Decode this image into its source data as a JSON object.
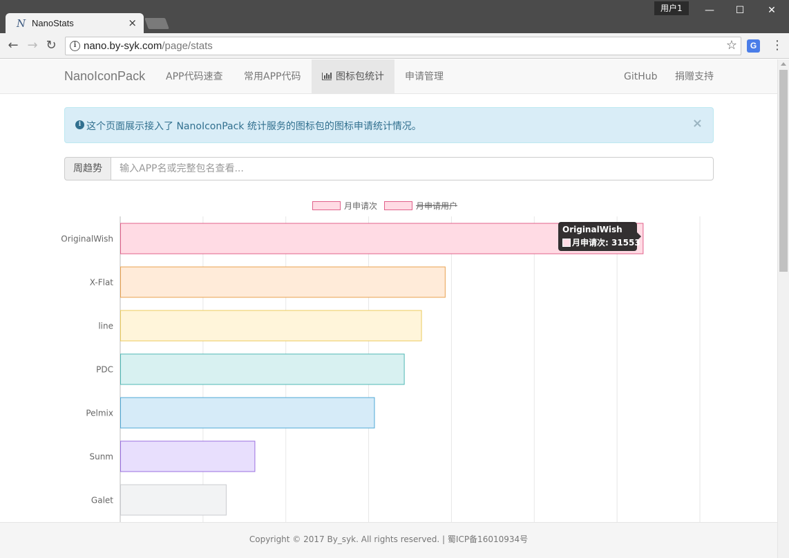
{
  "browser": {
    "tab_title": "NanoStats",
    "tab_favicon": "N",
    "profile_name": "用户1",
    "url_host": "nano.by-syk.com",
    "url_path": "/page/stats",
    "extension_letter": "G"
  },
  "navbar": {
    "brand": "NanoIconPack",
    "links": [
      {
        "label": "APP代码速查"
      },
      {
        "label": "常用APP代码"
      },
      {
        "label": "图标包统计",
        "active": true
      },
      {
        "label": "申请管理"
      }
    ],
    "right_links": [
      {
        "label": "GitHub"
      },
      {
        "label": "捐赠支持"
      }
    ]
  },
  "alert": {
    "text": "这个页面展示接入了 NanoIconPack 统计服务的图标包的图标申请统计情况。",
    "close_glyph": "×"
  },
  "search": {
    "addon_label": "周趋势",
    "placeholder": "输入APP名或完整包名查看..."
  },
  "chart_data": {
    "type": "bar",
    "orientation": "horizontal",
    "categories": [
      "OriginalWish",
      "X-Flat",
      "line",
      "PDC",
      "Pelmix",
      "Sunm",
      "Galet"
    ],
    "series": [
      {
        "name": "月申请次",
        "values": [
          31553,
          19600,
          18170,
          17130,
          15330,
          8110,
          6380
        ],
        "hidden": false
      },
      {
        "name": "月申请用户",
        "values": [],
        "hidden": true
      }
    ],
    "bar_colors": [
      {
        "fill": "#ffdbe4",
        "stroke": "#e0608a"
      },
      {
        "fill": "#ffebd9",
        "stroke": "#e8a14f"
      },
      {
        "fill": "#fff5da",
        "stroke": "#eccb5f"
      },
      {
        "fill": "#d8f1f1",
        "stroke": "#4fb8b5"
      },
      {
        "fill": "#d6ebf8",
        "stroke": "#4fa8d6"
      },
      {
        "fill": "#e8dffd",
        "stroke": "#9a6fe0"
      },
      {
        "fill": "#f2f3f4",
        "stroke": "#c9cbcf"
      }
    ],
    "legend_colors": {
      "fill": "#ffdbe4",
      "stroke": "#e0608a"
    },
    "xlim": [
      0,
      35000
    ],
    "grid": true,
    "legend_position": "top",
    "tooltip": {
      "title": "OriginalWish",
      "label": "月申请次: 31553"
    }
  },
  "footer": {
    "text": "Copyright © 2017 By_syk. All rights reserved. | 蜀ICP备16010934号"
  }
}
